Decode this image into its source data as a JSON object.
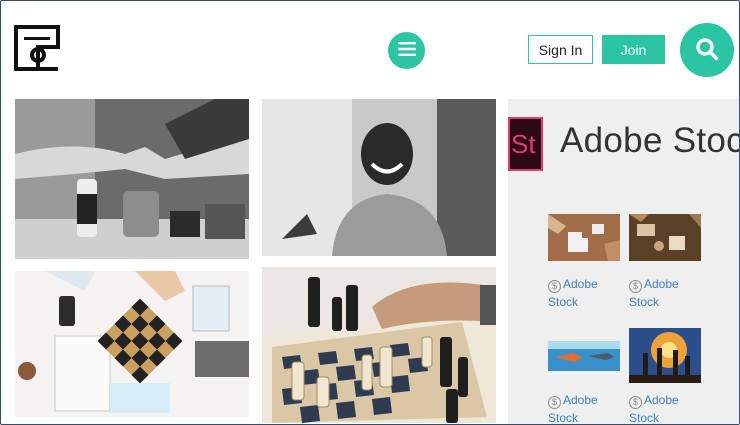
{
  "header": {
    "logo_icon": "site-logo-icon",
    "menu_icon": "hamburger-icon",
    "signin_label": "Sign In",
    "join_label": "Join",
    "search_icon": "search-icon"
  },
  "colors": {
    "accent": "#2cc5a3",
    "adobe_pink": "#e23c78",
    "link_blue": "#3b7fc4",
    "panel_bg": "#efefef"
  },
  "photos": [
    {
      "name": "teamwork-fist-bump-photo"
    },
    {
      "name": "smiling-man-photo"
    },
    {
      "name": "desk-checkers-overhead-photo"
    },
    {
      "name": "chess-game-photo"
    }
  ],
  "adobe_stock": {
    "logo_text": "St",
    "title": "Adobe Stock",
    "items": [
      {
        "credit_line1": "Adobe",
        "credit_line2": "Stock"
      },
      {
        "credit_line1": "Adobe",
        "credit_line2": "Stock"
      },
      {
        "credit_line1": "Adobe",
        "credit_line2": "Stock"
      },
      {
        "credit_line1": "Adobe",
        "credit_line2": "Stock"
      }
    ]
  }
}
